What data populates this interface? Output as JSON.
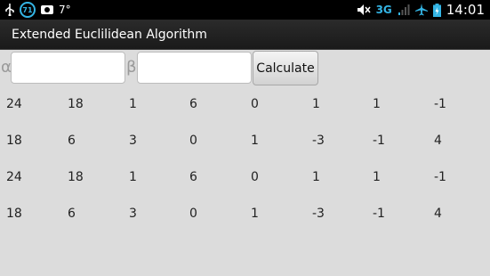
{
  "status_bar": {
    "notification_badge": "71",
    "temperature": "7°",
    "network_type": "3G",
    "time": "14:01",
    "icons": [
      "usb-icon",
      "notification-71-icon",
      "camera-icon",
      "mute-icon",
      "signal-icon",
      "airplane-icon",
      "battery-charging-icon"
    ]
  },
  "app": {
    "title": "Extended Euclilidean Algorithm"
  },
  "form": {
    "alpha_label": "α",
    "alpha_value": "",
    "beta_label": "β",
    "beta_value": "",
    "calculate_label": "Calculate"
  },
  "results": {
    "rows": [
      [
        "24",
        "18",
        "1",
        "6",
        "0",
        "1",
        "1",
        "-1"
      ],
      [
        "18",
        "6",
        "3",
        "0",
        "1",
        "-3",
        "-1",
        "4"
      ],
      [
        "24",
        "18",
        "1",
        "6",
        "0",
        "1",
        "1",
        "-1"
      ],
      [
        "18",
        "6",
        "3",
        "0",
        "1",
        "-3",
        "-1",
        "4"
      ]
    ]
  },
  "colors": {
    "background": "#dcdcdc",
    "status_accent": "#34b5e5",
    "title_bar": "#1f1f1f"
  }
}
